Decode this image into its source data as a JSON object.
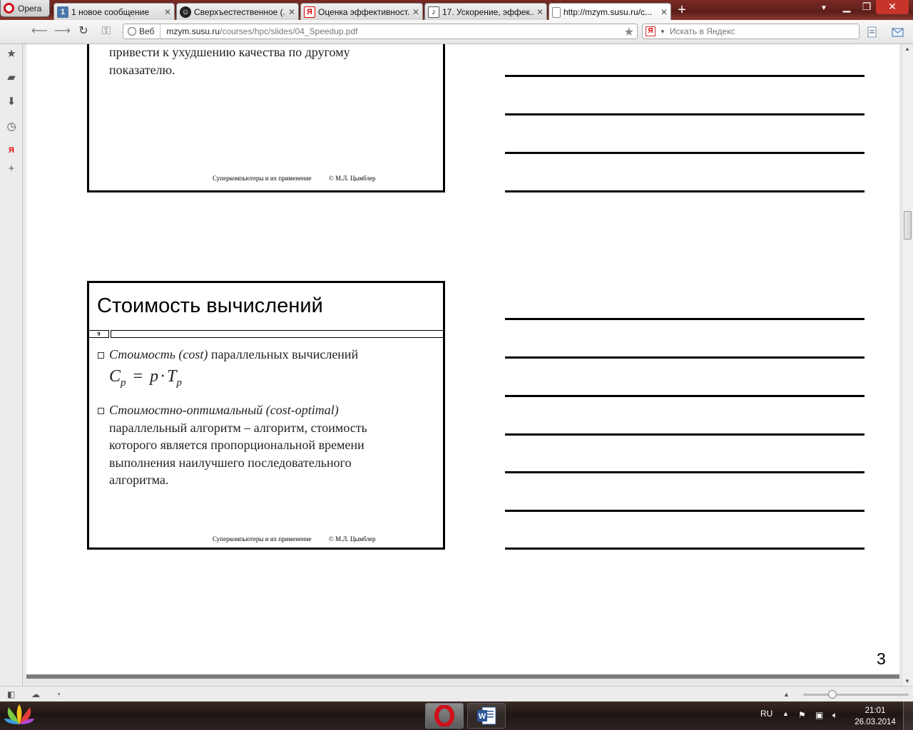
{
  "browser": {
    "menu_label": "Opera",
    "tabs": [
      {
        "title": "1 новое сообщение",
        "icon": "vk-icon"
      },
      {
        "title": "Сверхъестественное (...",
        "icon": "site-face-icon"
      },
      {
        "title": "Оценка эффективност...",
        "icon": "yandex-icon"
      },
      {
        "title": "17. Ускорение, эффек...",
        "icon": "doc-page-icon"
      },
      {
        "title": "http://mzym.susu.ru/c...",
        "icon": "blank-page-icon"
      }
    ],
    "address": {
      "scope_label": "Веб",
      "url_host": "mzym.susu.ru",
      "url_path": "/courses/hpc/slides/04_Speedup.pdf"
    },
    "search": {
      "placeholder": "Искать в Яндекс",
      "engine_letter": "Я"
    }
  },
  "document": {
    "slide_top": {
      "text_line1": "привести к ухудшению качества по другому",
      "text_line2": "показателю.",
      "footer_left": "Суперкомпьютеры и их применение",
      "footer_right": "© М.Л. Цымблер"
    },
    "slide_main": {
      "title": "Стоимость вычислений",
      "slide_number": "9",
      "bullet1_italic": "Стоимость (cost)",
      "bullet1_rest": " параллельных вычислений",
      "formula": {
        "C": "C",
        "sub_p": "p",
        "eq": "=",
        "p": "p",
        "dot": "·",
        "T": "T",
        "sub_p2": "p"
      },
      "bullet2_italic": "Стоимостно-оптимальный (cost-optimal)",
      "bullet2_lines": [
        "параллельный алгоритм – алгоритм, стоимость",
        "которого является пропорциональной времени",
        "выполнения наилучшего последовательного",
        "алгоритма."
      ],
      "footer_left": "Суперкомпьютеры и их применение",
      "footer_right": "© М.Л. Цымблер"
    },
    "page_number": "3"
  },
  "taskbar": {
    "language": "RU",
    "time": "21:01",
    "date": "26.03.2014"
  },
  "colors": {
    "tabbar": "#5c1e1a",
    "opera_red": "#d0101a",
    "page_bg": "#ffffff"
  }
}
